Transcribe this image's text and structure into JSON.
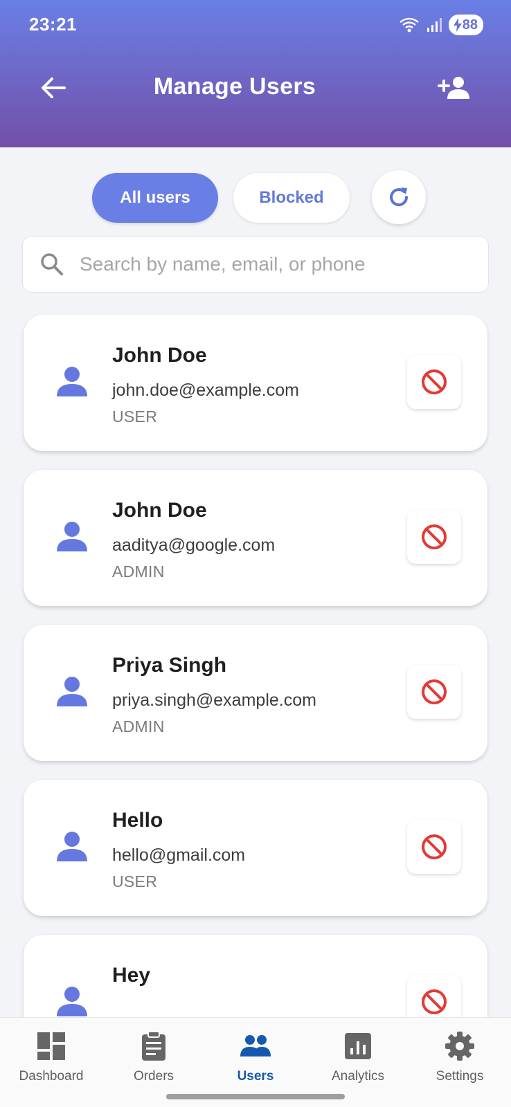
{
  "status_bar": {
    "time": "23:21",
    "battery": "88"
  },
  "header": {
    "title": "Manage Users"
  },
  "tabs": {
    "all": "All users",
    "blocked": "Blocked"
  },
  "search": {
    "placeholder": "Search by name, email, or phone"
  },
  "users": [
    {
      "name": "John Doe",
      "email": "john.doe@example.com",
      "role": "USER"
    },
    {
      "name": "John Doe",
      "email": "aaditya@google.com",
      "role": "ADMIN"
    },
    {
      "name": "Priya Singh",
      "email": "priya.singh@example.com",
      "role": "ADMIN"
    },
    {
      "name": "Hello",
      "email": "hello@gmail.com",
      "role": "USER"
    },
    {
      "name": "Hey",
      "email": "",
      "role": ""
    }
  ],
  "nav": {
    "dashboard": "Dashboard",
    "orders": "Orders",
    "users": "Users",
    "analytics": "Analytics",
    "settings": "Settings"
  },
  "colors": {
    "header_gradient_top": "#6a7fe6",
    "header_gradient_bottom": "#7250a8",
    "accent": "#6a7fe6",
    "block_icon": "#e53935",
    "nav_active": "#1558b0"
  }
}
